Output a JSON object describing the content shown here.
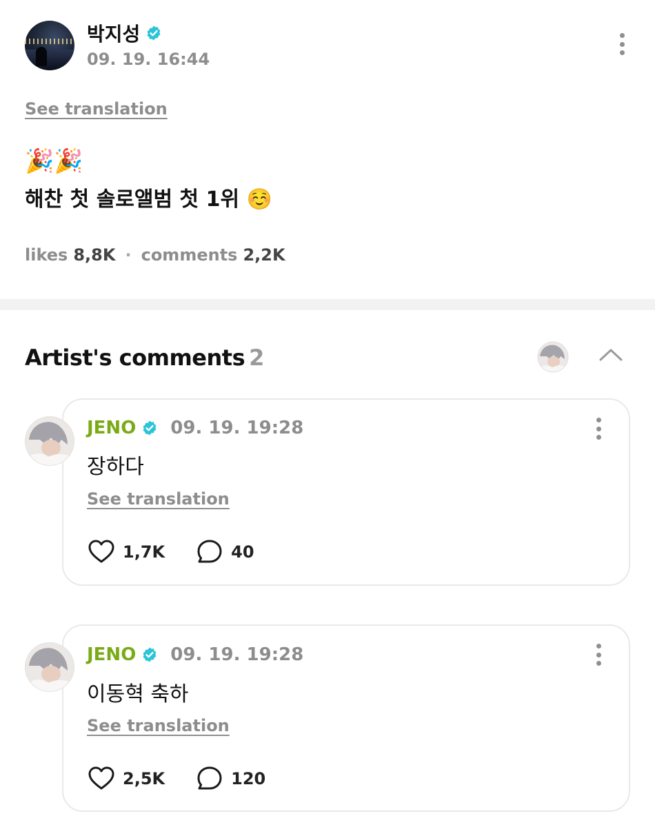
{
  "post": {
    "author": "박지성",
    "time": "09. 19. 16:44",
    "see_translation": "See translation",
    "party_emojis": "🎉🎉",
    "text": "해찬 첫 솔로앨범 첫 1위",
    "text_emoji": "☺️",
    "likes_label": "likes",
    "likes_count": "8,8K",
    "comments_label": "comments",
    "comments_count": "2,2K"
  },
  "section": {
    "title": "Artist's comments",
    "count": "2"
  },
  "comments": [
    {
      "name": "JENO",
      "time": "09. 19. 19:28",
      "text": "장하다",
      "see_translation": "See translation",
      "likes": "1,7K",
      "replies": "40"
    },
    {
      "name": "JENO",
      "time": "09. 19. 19:28",
      "text": "이동혁 축하",
      "see_translation": "See translation",
      "likes": "2,5K",
      "replies": "120"
    }
  ],
  "colors": {
    "verified": "#2bc4d8",
    "artist_name": "#7aab16",
    "muted": "#8d8d8d"
  },
  "icons": {
    "verified": "verified-badge-icon",
    "more": "more-vertical-icon",
    "like": "heart-icon",
    "reply": "comment-bubble-icon",
    "collapse": "chevron-up-icon"
  }
}
